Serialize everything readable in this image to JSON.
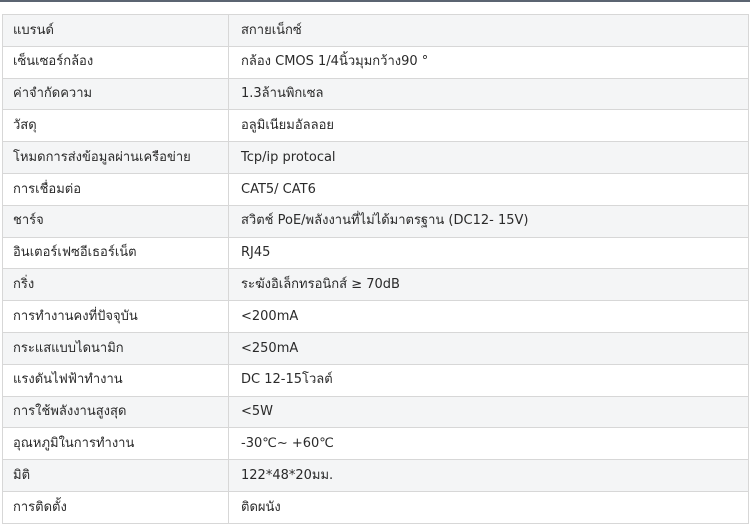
{
  "spec_table": {
    "rows": [
      {
        "label": "แบรนด์",
        "value": "สกายเน็กซ์"
      },
      {
        "label": "เซ็นเซอร์กล้อง",
        "value": "กล้อง CMOS 1/4นิ้วมุมกว้าง90 °"
      },
      {
        "label": "ค่าจำกัดความ",
        "value": "1.3ล้านพิกเซล"
      },
      {
        "label": "วัสดุ",
        "value": "อลูมิเนียมอัลลอย"
      },
      {
        "label": "โหมดการส่งข้อมูลผ่านเครือข่าย",
        "value": "Tcp/ip protocal"
      },
      {
        "label": "การเชื่อมต่อ",
        "value": "CAT5/ CAT6"
      },
      {
        "label": "ชาร์จ",
        "value": "สวิตช์ PoE/พลังงานที่ไม่ได้มาตรฐาน (DC12- 15V)"
      },
      {
        "label": "อินเตอร์เฟซอีเธอร์เน็ต",
        "value": "RJ45"
      },
      {
        "label": "กริ่ง",
        "value": "ระฆังอิเล็กทรอนิกส์ ≥ 70dB"
      },
      {
        "label": "การทำงานคงที่ปัจจุบัน",
        "value": "<200mA"
      },
      {
        "label": "กระแสแบบไดนามิก",
        "value": "<250mA"
      },
      {
        "label": "แรงดันไฟฟ้าทำงาน",
        "value": "DC 12-15โวลต์"
      },
      {
        "label": "การใช้พลังงานสูงสุด",
        "value": "<5W"
      },
      {
        "label": "อุณหภูมิในการทำงาน",
        "value": "-30℃~ +60℃"
      },
      {
        "label": "มิติ",
        "value": "122*48*20มม."
      },
      {
        "label": "การติดตั้ง",
        "value": "ติดผนัง"
      }
    ]
  }
}
